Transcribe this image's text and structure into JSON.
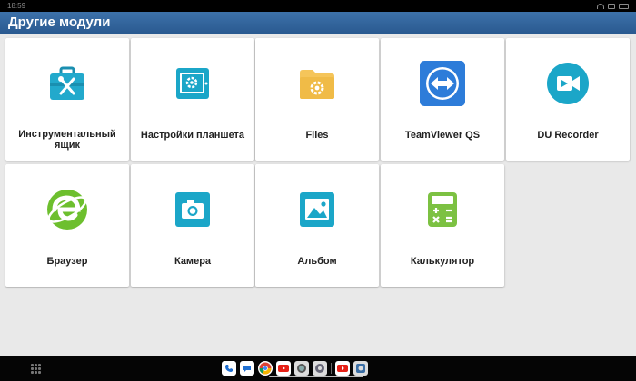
{
  "status_bar": {
    "time": "18:59"
  },
  "header": {
    "title": "Другие модули"
  },
  "modules": [
    {
      "label": "Инструментальный ящик",
      "icon": "toolbox-icon",
      "color": "#1ba6c8"
    },
    {
      "label": "Настройки планшета",
      "icon": "tablet-settings-icon",
      "color": "#1ba6c8"
    },
    {
      "label": "Files",
      "icon": "folder-icon",
      "color": "#f2c14e"
    },
    {
      "label": "TeamViewer QS",
      "icon": "teamviewer-icon",
      "color": "#2d7cd9"
    },
    {
      "label": "DU Recorder",
      "icon": "du-recorder-icon",
      "color": "#1ba6c8"
    },
    {
      "label": "Браузер",
      "icon": "browser-icon",
      "color": "#6dbf2e"
    },
    {
      "label": "Камера",
      "icon": "camera-icon",
      "color": "#1ba6c8"
    },
    {
      "label": "Альбом",
      "icon": "album-icon",
      "color": "#1ba6c8"
    },
    {
      "label": "Калькулятор",
      "icon": "calculator-icon",
      "color": "#7cc142"
    }
  ],
  "dock": [
    {
      "icon": "phone-icon"
    },
    {
      "icon": "messages-icon"
    },
    {
      "icon": "chrome-icon"
    },
    {
      "icon": "youtube-icon"
    },
    {
      "icon": "camera-app-icon"
    },
    {
      "icon": "settings-app-icon"
    },
    {
      "icon": "youtube-recent-icon"
    },
    {
      "icon": "recent-app-icon"
    }
  ]
}
